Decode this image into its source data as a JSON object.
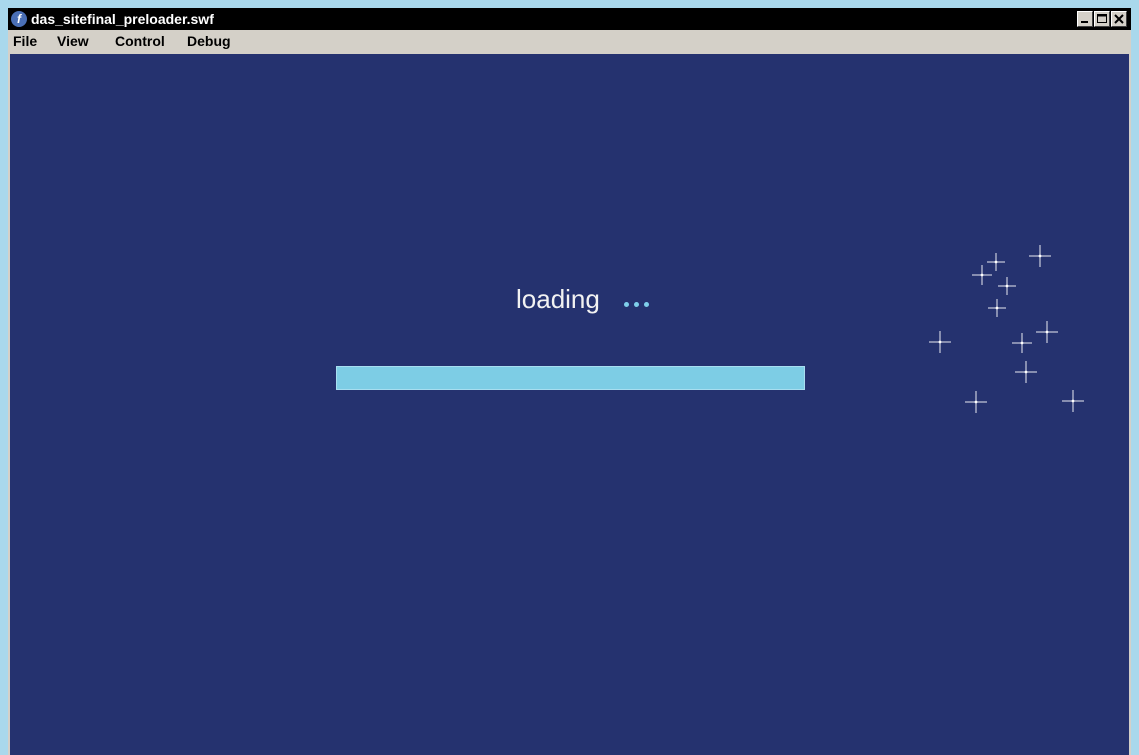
{
  "window": {
    "title": "das_sitefinal_preloader.swf",
    "app_icon": "flash-player-icon",
    "controls": {
      "minimize_icon": "minimize-icon",
      "maximize_icon": "maximize-icon",
      "close_icon": "close-icon"
    }
  },
  "menu": {
    "items": [
      "File",
      "View",
      "Control",
      "Debug"
    ]
  },
  "preloader": {
    "label": "loading",
    "progress_fraction": 1.0
  },
  "colors": {
    "stage_background": "#25326f",
    "progress_fill": "#7dcde5",
    "dots": "#7fcfea",
    "titlebar": "#000000",
    "desktop": "#a9d8ec"
  },
  "decorations": {
    "sparkle_icon": "sparkle-icon"
  }
}
